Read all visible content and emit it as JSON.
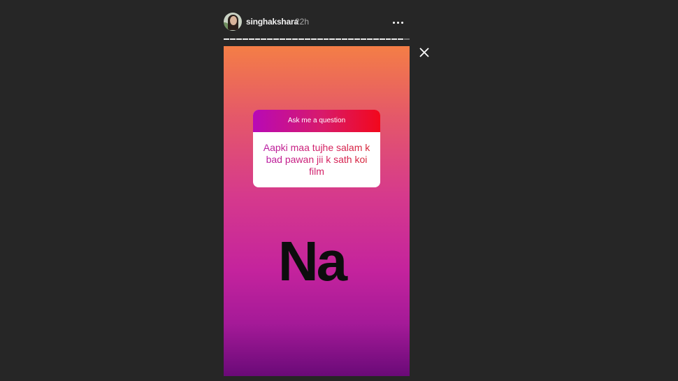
{
  "header": {
    "username": "singhakshara",
    "time_ago": "22h"
  },
  "progress": {
    "segments_total": 30,
    "segments_viewed": 29
  },
  "story": {
    "question_sticker": {
      "title": "Ask me a question",
      "question": "Aapki maa tujhe salam k bad pawan jii k sath koi film"
    },
    "answer_text": "Na"
  },
  "icons": {
    "more": "more-options-icon",
    "close": "close-icon"
  },
  "colors": {
    "background": "#262626",
    "gradient_top": "#f47e46",
    "gradient_bottom": "#6a0a78",
    "sticker_header_start": "#b809b6",
    "sticker_header_end": "#f2081c"
  }
}
